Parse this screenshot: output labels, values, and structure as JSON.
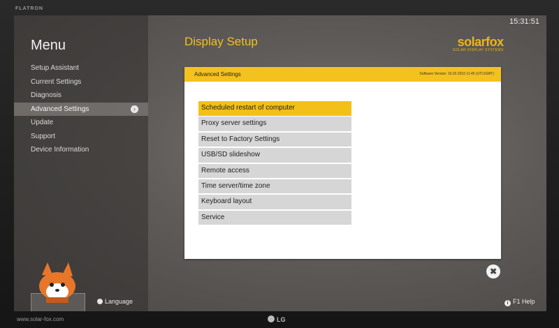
{
  "monitor": {
    "brand": "FLATRON",
    "maker": "LG"
  },
  "clock": "15:31:51",
  "sidebar": {
    "title": "Menu",
    "items": [
      {
        "label": "Setup Assistant"
      },
      {
        "label": "Current Settings"
      },
      {
        "label": "Diagnosis"
      },
      {
        "label": "Advanced Settings",
        "active": true
      },
      {
        "label": "Update"
      },
      {
        "label": "Support"
      },
      {
        "label": "Device Information"
      }
    ],
    "language_label": "Language",
    "website": "www.solar-fox.com"
  },
  "header": {
    "page_title": "Display Setup",
    "logo_word": "solarfox",
    "logo_sub": "SOLAR DISPLAY SYSTEMS"
  },
  "dialog": {
    "title": "Advanced Settings",
    "version": "Software Version: 16.02.2016 11:45 (UTC/GMT)",
    "options": [
      {
        "label": "Scheduled restart of computer",
        "selected": true
      },
      {
        "label": "Proxy server settings"
      },
      {
        "label": "Reset to Factory Settings"
      },
      {
        "label": "USB/SD slideshow"
      },
      {
        "label": "Remote access"
      },
      {
        "label": "Time server/time zone"
      },
      {
        "label": "Keyboard layout"
      },
      {
        "label": "Service"
      }
    ]
  },
  "footer": {
    "help_label": "F1 Help"
  },
  "colors": {
    "accent": "#f3c019",
    "logo": "#f0b418"
  }
}
